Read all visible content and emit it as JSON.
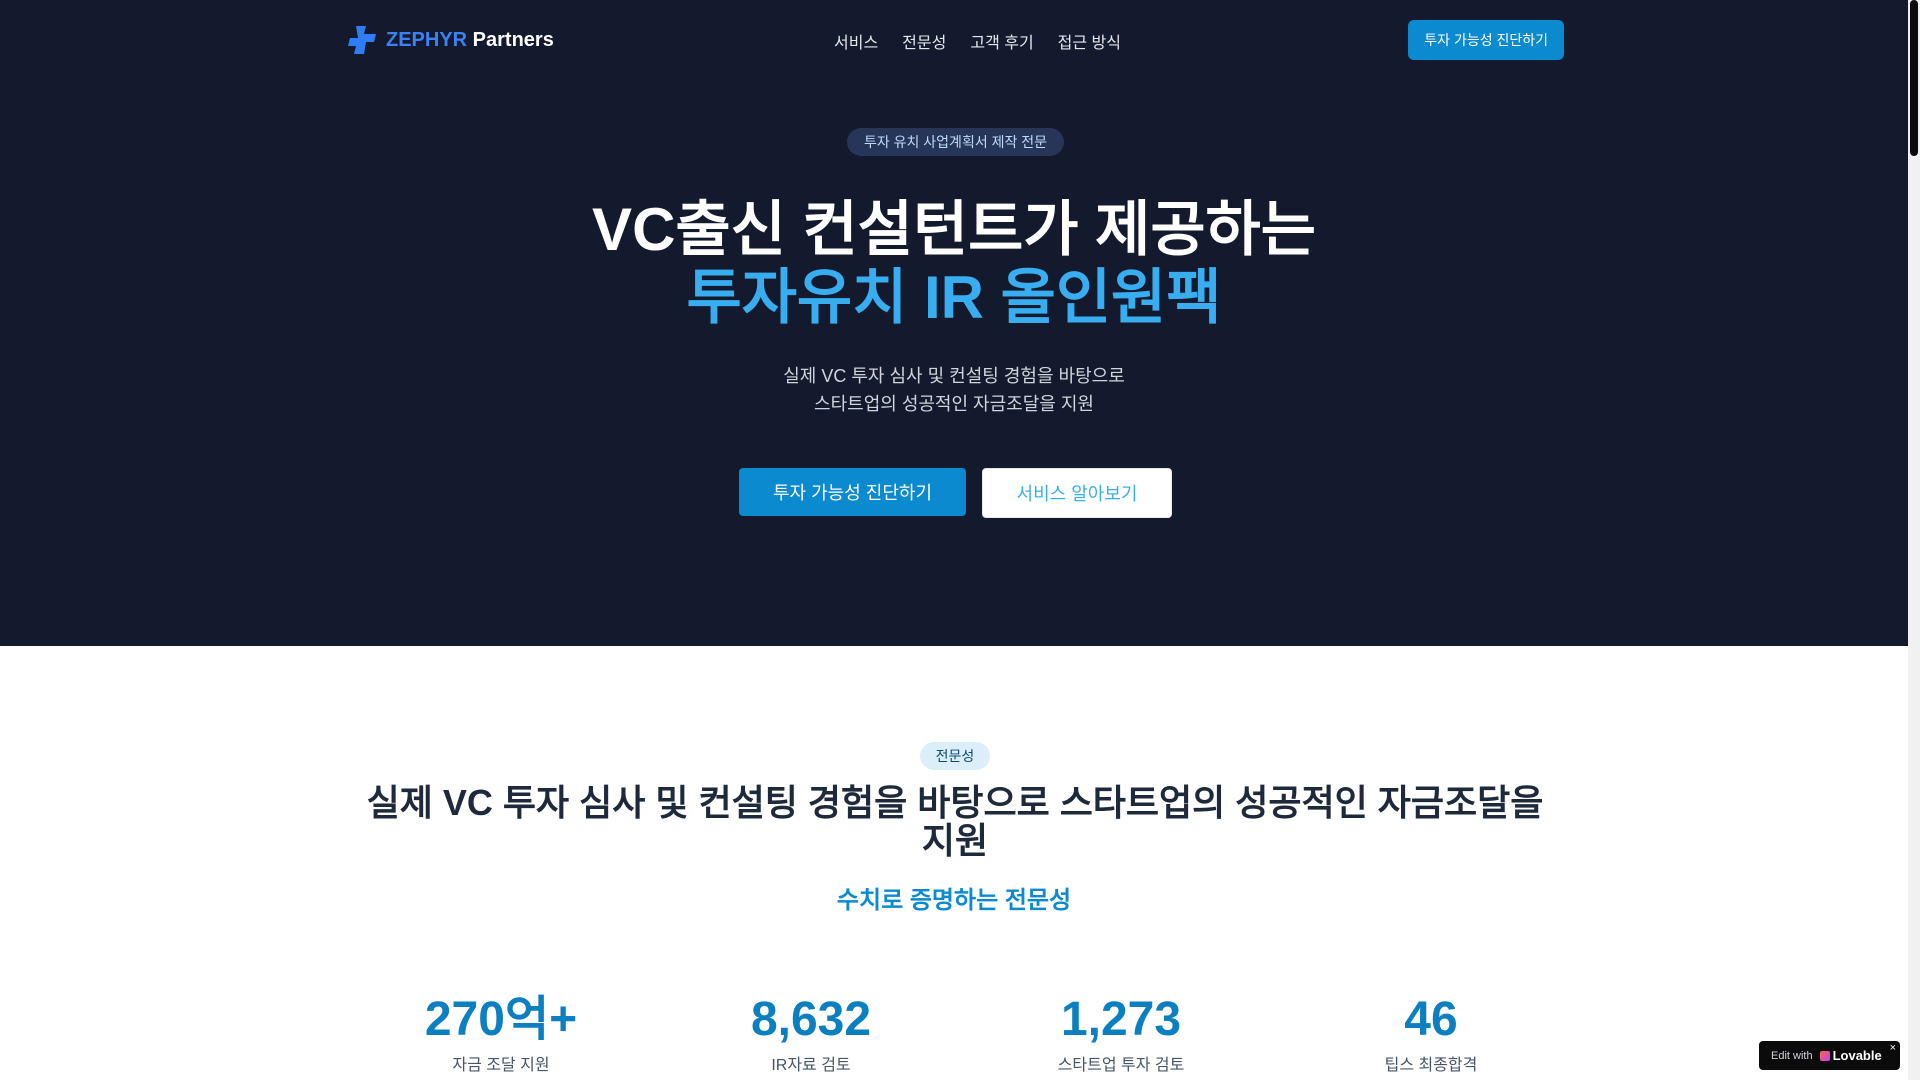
{
  "brand": {
    "accent": "ZEPHYR",
    "rest": " Partners",
    "color": "#3b82f6"
  },
  "nav": {
    "links": [
      "서비스",
      "전문성",
      "고객 후기",
      "접근 방식"
    ],
    "cta": "투자 가능성 진단하기"
  },
  "hero": {
    "badge": "투자 유치 사업계획서 제작 전문",
    "title_line1": "VC출신 컨설턴트가 제공하는",
    "title_line2": "투자유치 IR 올인원팩",
    "subtitle_line1": "실제 VC 투자 심사 및 컨설팅 경험을 바탕으로",
    "subtitle_line2": "스타트업의 성공적인 자금조달을 지원",
    "primary_button": "투자 가능성 진단하기",
    "secondary_button": "서비스 알아보기",
    "background": "#141a2e",
    "accent": "#38aef0"
  },
  "expertise": {
    "badge": "전문성",
    "title": "실제 VC 투자 심사 및 컨설팅 경험을 바탕으로 스타트업의 성공적인 자금조달을 지원",
    "subtitle": "수치로 증명하는 전문성",
    "stats": [
      {
        "value": "270억+",
        "label": "자금 조달 지원"
      },
      {
        "value": "8,632",
        "label": "IR자료 검토"
      },
      {
        "value": "1,273",
        "label": "스타트업 투자 검토"
      },
      {
        "value": "46",
        "label": "팁스 최종합격"
      }
    ]
  },
  "lovable_badge": {
    "prefix": "Edit with",
    "brand": "Lovable",
    "close": "×"
  }
}
